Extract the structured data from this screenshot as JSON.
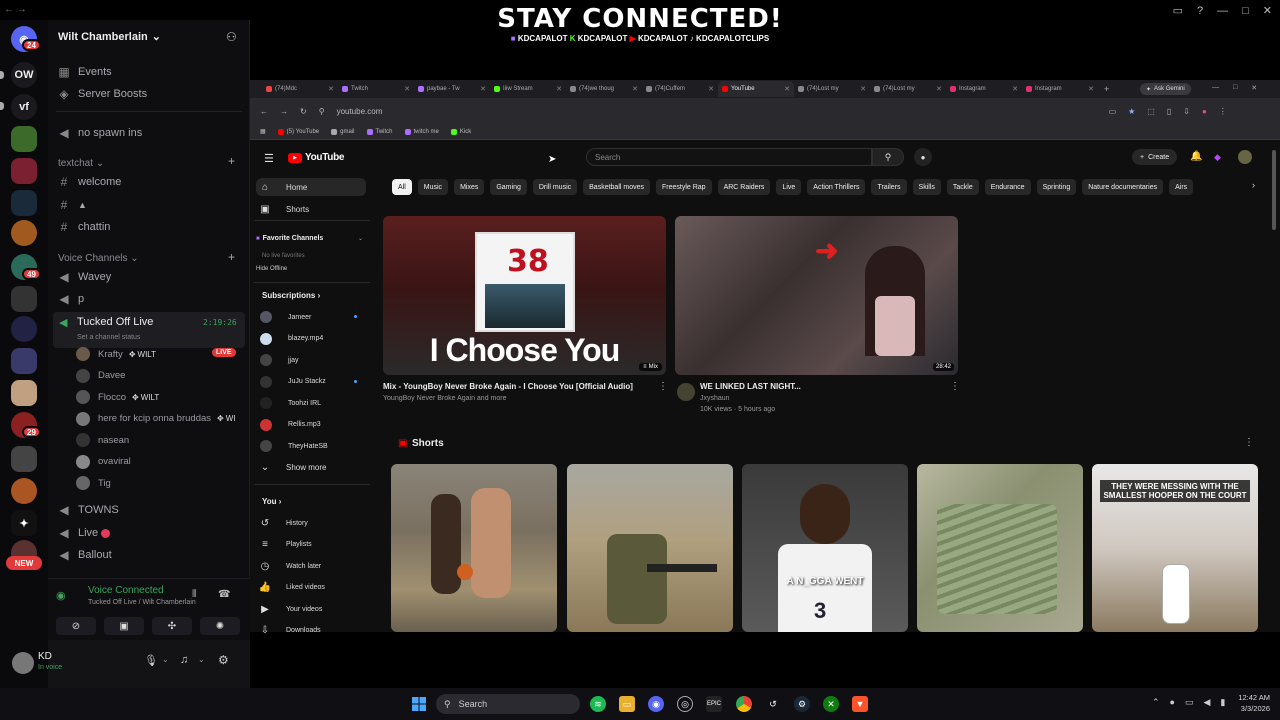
{
  "overlay": {
    "title": "STAY CONNECTED!",
    "socials": [
      "KDCAPALOT",
      "KDCAPALOT",
      "KDCAPALOT",
      "KDCAPALOTCLIPS"
    ]
  },
  "rail": {
    "home_badge": "24",
    "server_ow": "OW",
    "server_vf": "vf",
    "badges": [
      "49",
      "29"
    ],
    "new_label": "NEW"
  },
  "discord": {
    "server_name": "Wilt Chamberlain",
    "top_items": [
      "Events",
      "Server Boosts"
    ],
    "no_spawn": "no spawn ins",
    "textchat_category": "textchat",
    "text_channels": [
      "welcome",
      "",
      "chattin"
    ],
    "voice_category": "Voice Channels",
    "voice_channels": [
      "Wavey",
      "p"
    ],
    "active_voice": {
      "name": "Tucked Off Live",
      "timer": "2:19:26",
      "status": "Set a channel status"
    },
    "members": [
      {
        "name": "Krafty",
        "tag": "WILT",
        "live": "LIVE",
        "color": "#6b5a4a"
      },
      {
        "name": "Davee",
        "tag": "",
        "live": "",
        "color": "#444"
      },
      {
        "name": "Flocco",
        "tag": "WILT",
        "live": "",
        "color": "#555"
      },
      {
        "name": "here for kcip onna bruddas",
        "tag": "WI",
        "live": "",
        "color": "#777"
      },
      {
        "name": "nasean",
        "tag": "",
        "live": "",
        "color": "#333"
      },
      {
        "name": "ovaviral",
        "tag": "",
        "live": "",
        "color": "#888"
      },
      {
        "name": "Tig",
        "tag": "",
        "live": "",
        "color": "#666"
      }
    ],
    "more_channels": [
      "TOWNS",
      "Live",
      "Ballout"
    ],
    "voice_connected": "Voice Connected",
    "voice_location": "Tucked Off Live / Wilt Chamberlain",
    "user": {
      "name": "KD",
      "status": "In voice"
    }
  },
  "browser": {
    "tabs": [
      "(74)Mdc",
      "Twitch",
      "paybae - Tw",
      "Iiiw Stream",
      "(74)we thoug",
      "(74)Cuffem",
      "YouTube",
      "(74)Lost my",
      "(74)Lost my",
      "Instagram",
      "Instagram"
    ],
    "active_tab": 6,
    "ask_gemini": "Ask Gemini",
    "url": "youtube.com",
    "bookmarks": [
      "(5) YouTube",
      "gmail",
      "Twitch",
      "twitch me",
      "Kick"
    ]
  },
  "youtube": {
    "logo": "YouTube",
    "search_placeholder": "Search",
    "create": "Create",
    "nav_top": [
      "Home",
      "Shorts"
    ],
    "favorite_channels": "Favorite Channels",
    "no_live_favorites": "No live favorites",
    "hide_offline": "Hide Offline",
    "subscriptions": "Subscriptions",
    "subs": [
      "Jameer",
      "blazey.mp4",
      "jjay",
      "JuJu Stackz",
      "Toohzi IRL",
      "Rellis.mp3",
      "TheyHateSB"
    ],
    "show_more": "Show more",
    "you": "You",
    "you_items": [
      "History",
      "Playlists",
      "Watch later",
      "Liked videos",
      "Your videos",
      "Downloads"
    ],
    "chips": [
      "All",
      "Music",
      "Mixes",
      "Gaming",
      "Drill music",
      "Basketball moves",
      "Freestyle Rap",
      "ARC Raiders",
      "Live",
      "Action Thrillers",
      "Trailers",
      "Skills",
      "Tackle",
      "Endurance",
      "Sprinting",
      "Nature documentaries",
      "Airs"
    ],
    "videos": [
      {
        "title": "Mix - YoungBoy Never Broke Again - I Choose You [Official Audio]",
        "meta": "YoungBoy Never Broke Again and more",
        "thumb_text": "I Choose You",
        "cover": "38",
        "badge": "Mix"
      },
      {
        "title": "WE LINKED LAST NIGHT...",
        "channel": "Jxyshaun",
        "meta": "10K views · 5 hours ago",
        "duration": "28:42"
      }
    ],
    "shorts_title": "Shorts",
    "shorts_captions": [
      "",
      "",
      "A N_GGA WENT",
      "",
      "THEY WERE MESSING WITH THE SMALLEST HOOPER ON THE COURT"
    ]
  },
  "taskbar": {
    "search": "Search",
    "time": "12:42 AM",
    "date": "3/3/2026"
  }
}
